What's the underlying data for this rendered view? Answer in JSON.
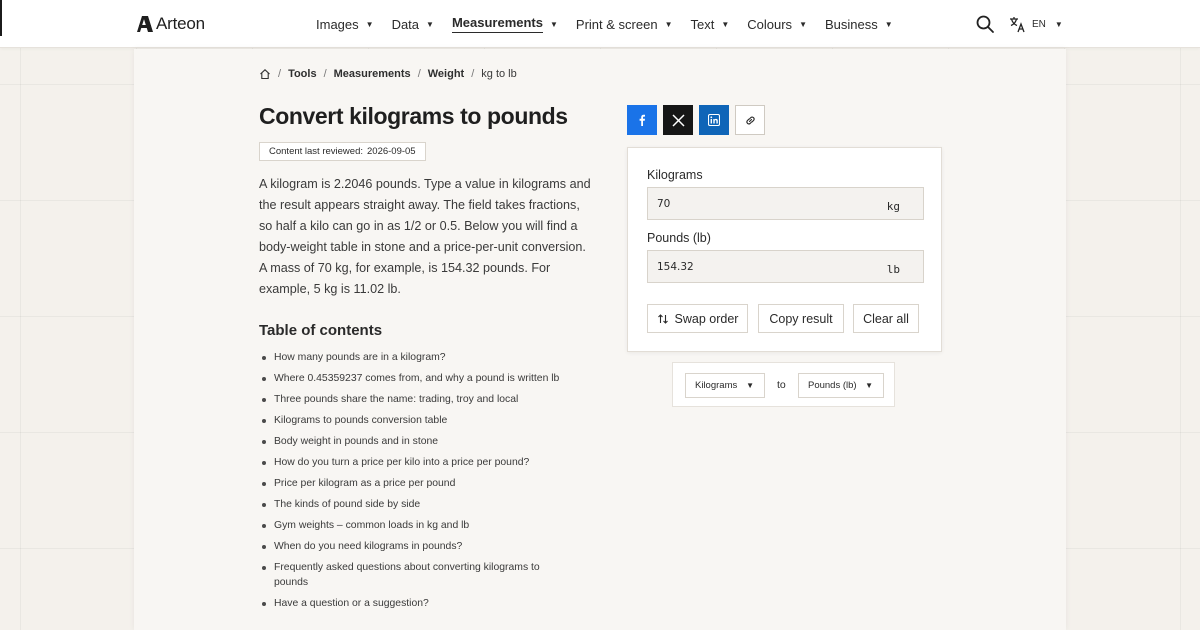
{
  "brand": {
    "name": "Arteon"
  },
  "nav": {
    "items": [
      {
        "label": "Images",
        "active": false
      },
      {
        "label": "Data",
        "active": false
      },
      {
        "label": "Measurements",
        "active": true
      },
      {
        "label": "Print & screen",
        "active": false
      },
      {
        "label": "Text",
        "active": false
      },
      {
        "label": "Colours",
        "active": false
      },
      {
        "label": "Business",
        "active": false
      }
    ],
    "language": "EN"
  },
  "breadcrumb": [
    "Tools",
    "Measurements",
    "Weight"
  ],
  "breadcrumb_current": "kg to lb",
  "page": {
    "title": "Convert kilograms to pounds",
    "reviewed_label": "Content last reviewed:",
    "reviewed_date": "2026-09-05",
    "intro": "A kilogram is 2.2046 pounds. Type a value in kilograms and the result appears straight away. The field takes fractions, so half a kilo can go in as 1/2 or 0.5. Below you will find a body-weight table in stone and a price-per-unit conversion. A mass of 70 kg, for example, is 154.32 pounds. For example, 5 kg is 11.02 lb."
  },
  "toc": {
    "title": "Table of contents",
    "items": [
      "How many pounds are in a kilogram?",
      "Where 0.45359237 comes from, and why a pound is written lb",
      "Three pounds share the name: trading, troy and local",
      "Kilograms to pounds conversion table",
      "Body weight in pounds and in stone",
      "How do you turn a price per kilo into a price per pound?",
      "Price per kilogram as a price per pound",
      "The kinds of pound side by side",
      "Gym weights – common loads in kg and lb",
      "When do you need kilograms in pounds?",
      "Frequently asked questions about converting kilograms to pounds",
      "Have a question or a suggestion?"
    ]
  },
  "converter": {
    "input_label": "Kilograms",
    "input_value": "70",
    "input_unit": "kg",
    "output_label": "Pounds (lb)",
    "output_value": "154.32",
    "output_unit": "lb",
    "swap_label": "Swap order",
    "copy_label": "Copy result",
    "clear_label": "Clear all"
  },
  "unit_select": {
    "from": "Kilograms",
    "to_word": "to",
    "to": "Pounds (lb)"
  },
  "colors": {
    "facebook": "#1a73e8",
    "x": "#161616",
    "linkedin": "#0f65b8",
    "page_bg": "#f4f1ec"
  }
}
